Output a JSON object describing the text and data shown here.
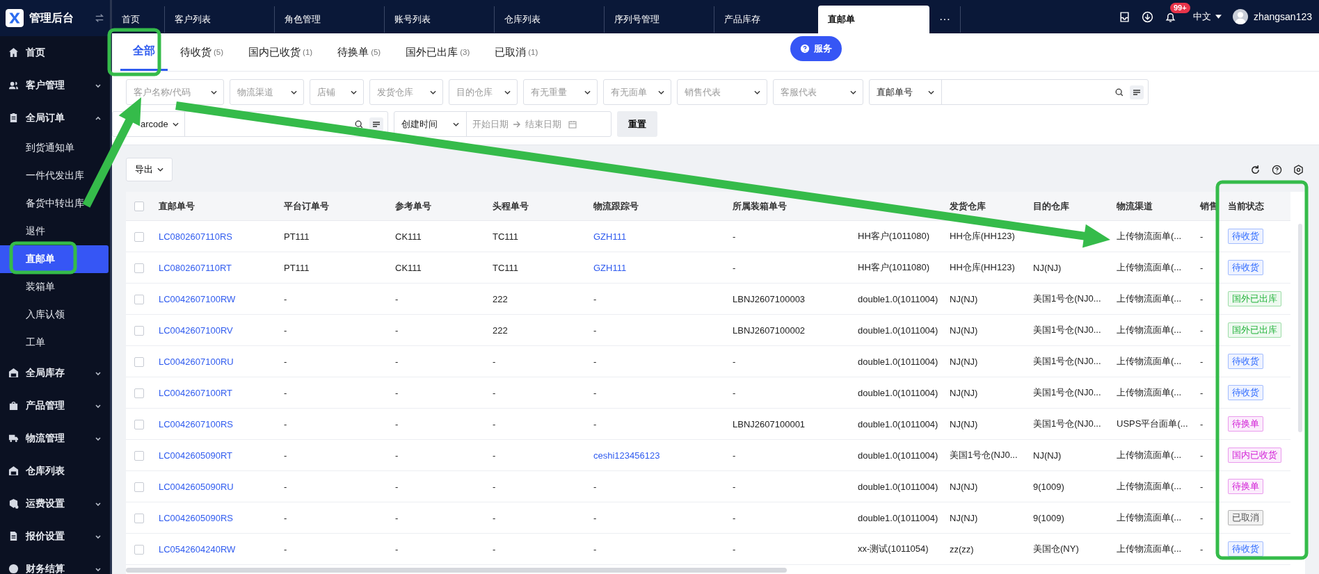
{
  "app": {
    "title": "管理后台"
  },
  "sidebar": {
    "items": [
      {
        "label": "首页",
        "expandable": false,
        "expanded": false,
        "selected": false
      },
      {
        "label": "客户管理",
        "expandable": true,
        "expanded": false,
        "selected": false
      },
      {
        "label": "全局订单",
        "expandable": true,
        "expanded": true,
        "selected": false,
        "children": [
          {
            "label": "到货通知单",
            "selected": false
          },
          {
            "label": "一件代发出库",
            "selected": false
          },
          {
            "label": "备货中转出库",
            "selected": false
          },
          {
            "label": "退件",
            "selected": false
          },
          {
            "label": "直邮单",
            "selected": true
          },
          {
            "label": "装箱单",
            "selected": false
          },
          {
            "label": "入库认领",
            "selected": false
          },
          {
            "label": "工单",
            "selected": false
          }
        ]
      },
      {
        "label": "全局库存",
        "expandable": true,
        "expanded": false,
        "selected": false
      },
      {
        "label": "产品管理",
        "expandable": true,
        "expanded": false,
        "selected": false
      },
      {
        "label": "物流管理",
        "expandable": true,
        "expanded": false,
        "selected": false
      },
      {
        "label": "仓库列表",
        "expandable": false,
        "expanded": false,
        "selected": false
      },
      {
        "label": "运费设置",
        "expandable": true,
        "expanded": false,
        "selected": false
      },
      {
        "label": "报价设置",
        "expandable": true,
        "expanded": false,
        "selected": false
      },
      {
        "label": "财务结算",
        "expandable": true,
        "expanded": false,
        "selected": false
      }
    ]
  },
  "page_tabs": [
    {
      "label": "首页",
      "selected": false
    },
    {
      "label": "客户列表",
      "selected": false
    },
    {
      "label": "角色管理",
      "selected": false
    },
    {
      "label": "账号列表",
      "selected": false
    },
    {
      "label": "仓库列表",
      "selected": false
    },
    {
      "label": "序列号管理",
      "selected": false
    },
    {
      "label": "产品库存",
      "selected": false
    },
    {
      "label": "直邮单",
      "selected": true
    }
  ],
  "more_tabs": "···",
  "header": {
    "notifications": "99+",
    "language": "中文",
    "user": "zhangsan123"
  },
  "status_tabs": [
    {
      "label": "全部",
      "selected": true
    },
    {
      "label": "待收货",
      "count": "(5)",
      "selected": false
    },
    {
      "label": "国内已收货",
      "count": "(1)",
      "selected": false
    },
    {
      "label": "待换单",
      "count": "(5)",
      "selected": false
    },
    {
      "label": "国外已出库",
      "count": "(3)",
      "selected": false
    },
    {
      "label": "已取消",
      "count": "(1)",
      "selected": false
    }
  ],
  "service_button": "服务",
  "filters": [
    {
      "placeholder": "客户名称/代码"
    },
    {
      "placeholder": "物流渠道"
    },
    {
      "placeholder": "店铺"
    },
    {
      "placeholder": "发货仓库"
    },
    {
      "placeholder": "目的仓库"
    },
    {
      "placeholder": "有无重量"
    },
    {
      "placeholder": "有无面单"
    },
    {
      "placeholder": "销售代表"
    },
    {
      "placeholder": "客服代表"
    }
  ],
  "search_type": "直邮单号",
  "barcode_type": "arcode",
  "date_type": "创建时间",
  "date_range": {
    "start_placeholder": "开始日期",
    "end_placeholder": "结束日期"
  },
  "reset_button": "重置",
  "export_button": "导出",
  "table": {
    "select_all_checked": false,
    "columns": [
      {
        "label": "直邮单号"
      },
      {
        "label": "平台订单号"
      },
      {
        "label": "参考单号"
      },
      {
        "label": "头程单号"
      },
      {
        "label": "物流跟踪号"
      },
      {
        "label": "所属装箱单号"
      },
      {},
      {
        "label": "发货仓库"
      },
      {
        "label": "目的仓库"
      },
      {
        "label": "物流渠道"
      },
      {
        "label": "销售"
      },
      {
        "label": "当前状态"
      }
    ],
    "rows": [
      {
        "checked": false,
        "cells": [
          "LC0802607110RS",
          "PT111",
          "CK111",
          "TC111",
          {
            "link": "GZH111"
          },
          "-",
          "HH客户(1011080)",
          "HH仓库(HH123)",
          null,
          "上传物流面单(...",
          "-"
        ],
        "status": {
          "label": "待收货",
          "color": "#2f6bff"
        }
      },
      {
        "checked": false,
        "cells": [
          "LC0802607110RT",
          "PT111",
          "CK111",
          "TC111",
          {
            "link": "GZH111"
          },
          "-",
          "HH客户(1011080)",
          "HH仓库(HH123)",
          "NJ(NJ)",
          "上传物流面单(...",
          "-"
        ],
        "status": {
          "label": "待收货",
          "color": "#2f6bff"
        }
      },
      {
        "checked": false,
        "cells": [
          "LC0042607100RW",
          "-",
          "-",
          "222",
          "-",
          "LBNJ2607100003",
          "double1.0(1011004)",
          "NJ(NJ)",
          "美国1号仓(NJ0...",
          "上传物流面单(...",
          "-"
        ],
        "status": {
          "label": "国外已出库",
          "color": "#22b33a"
        }
      },
      {
        "checked": false,
        "cells": [
          "LC0042607100RV",
          "-",
          "-",
          "222",
          "-",
          "LBNJ2607100002",
          "double1.0(1011004)",
          "NJ(NJ)",
          "美国1号仓(NJ0...",
          "上传物流面单(...",
          "-"
        ],
        "status": {
          "label": "国外已出库",
          "color": "#22b33a"
        }
      },
      {
        "checked": false,
        "cells": [
          "LC0042607100RU",
          "-",
          "-",
          "-",
          "-",
          "-",
          "double1.0(1011004)",
          "NJ(NJ)",
          "美国1号仓(NJ0...",
          "上传物流面单(...",
          "-"
        ],
        "status": {
          "label": "待收货",
          "color": "#2f6bff"
        }
      },
      {
        "checked": false,
        "cells": [
          "LC0042607100RT",
          "-",
          "-",
          "-",
          "-",
          "-",
          "double1.0(1011004)",
          "NJ(NJ)",
          "美国1号仓(NJ0...",
          "上传物流面单(...",
          "-"
        ],
        "status": {
          "label": "待收货",
          "color": "#2f6bff"
        }
      },
      {
        "checked": false,
        "cells": [
          "LC0042607100RS",
          "-",
          "-",
          "-",
          "-",
          "LBNJ2607100001",
          "double1.0(1011004)",
          "NJ(NJ)",
          "美国1号仓(NJ0...",
          "USPS平台面单(...",
          "-"
        ],
        "status": {
          "label": "待换单",
          "color": "#d21fd6"
        }
      },
      {
        "checked": false,
        "cells": [
          "LC0042605090RT",
          "-",
          "-",
          "-",
          {
            "link": "ceshi123456123"
          },
          "-",
          "double1.0(1011004)",
          "美国1号仓(NJ0...",
          "NJ(NJ)",
          "上传物流面单(...",
          "-"
        ],
        "status": {
          "label": "国内已收货",
          "color": "#d21fd6"
        }
      },
      {
        "checked": false,
        "cells": [
          "LC0042605090RU",
          "-",
          "-",
          "-",
          "-",
          "-",
          "double1.0(1011004)",
          "NJ(NJ)",
          "9(1009)",
          "上传物流面单(...",
          "-"
        ],
        "status": {
          "label": "待换单",
          "color": "#d21fd6"
        }
      },
      {
        "checked": false,
        "cells": [
          "LC0042605090RS",
          "-",
          "-",
          "-",
          "-",
          "-",
          "double1.0(1011004)",
          "NJ(NJ)",
          "9(1009)",
          "上传物流面单(...",
          "-"
        ],
        "status": {
          "label": "已取消",
          "color": "#555555"
        }
      },
      {
        "checked": false,
        "cells": [
          "LC0542604240RW",
          "-",
          "-",
          "-",
          "-",
          "-",
          "xx-测试(1011054)",
          "zz(zz)",
          "美国仓(NY)",
          "上传物流面单(...",
          "-"
        ],
        "status": {
          "label": "待收货",
          "color": "#2f6bff"
        }
      }
    ]
  },
  "annotations": [
    {
      "kind": "box"
    },
    {
      "kind": "box"
    },
    {
      "kind": "box"
    },
    {
      "kind": "arrow"
    },
    {
      "kind": "arrow"
    }
  ]
}
